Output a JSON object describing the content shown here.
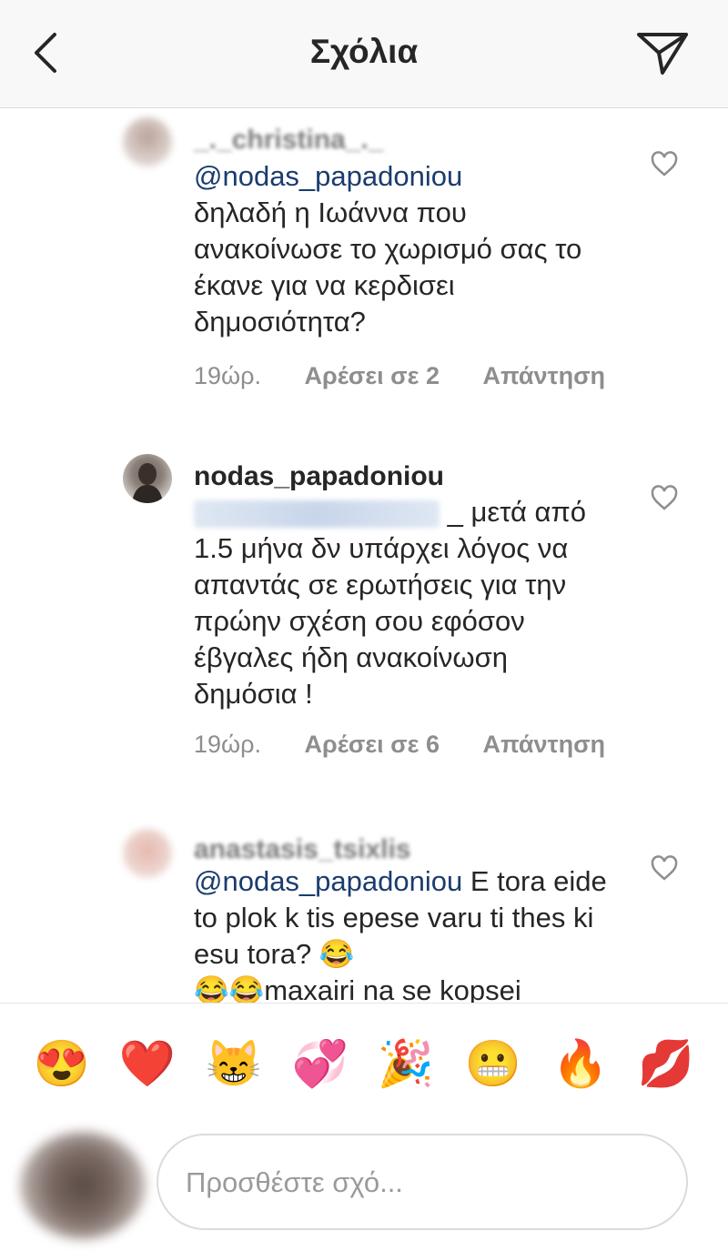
{
  "header": {
    "title": "Σχόλια",
    "back_icon": "chevron-left-icon",
    "share_icon": "paper-plane-icon"
  },
  "comments": [
    {
      "username": "_._christina_._",
      "mention": "@nodas_papadoniou",
      "text": "δηλαδή η Ιωάννα που ανακοίνωσε το χωρισμό σας το έκανε για να κερδισει δημοσιότητα?",
      "time": "19ώρ.",
      "likes": "Αρέσει σε 2",
      "reply": "Απάντηση"
    },
    {
      "username": "nodas_papadoniou",
      "mention_blurred": "@_._christina_._",
      "text": "_ μετά από 1.5 μήνα δν υπάρχει λόγος να απαντάς σε ερωτήσεις για την πρώην σχέση σου εφόσον έβγαλες ήδη ανακοίνωση δημόσια !",
      "time": "19ώρ.",
      "likes": "Αρέσει σε 6",
      "reply": "Απάντηση"
    },
    {
      "username": "anastasis_tsixlis",
      "mention": "@nodas_papadoniou",
      "text": " E tora eide to plok k tis epese varu ti thes ki esu tora? 😂",
      "text2": "😂😂maxairi na se kopsei"
    }
  ],
  "emoji_bar": [
    "😍",
    "❤️",
    "😸",
    "💞",
    "🎉",
    "😬",
    "🔥",
    "💋"
  ],
  "composer": {
    "placeholder": "Προσθέστε σχό..."
  },
  "colors": {
    "mention": "#1b3c6e",
    "meta": "#8e8e8e",
    "header_bg": "#f8f8f8"
  }
}
